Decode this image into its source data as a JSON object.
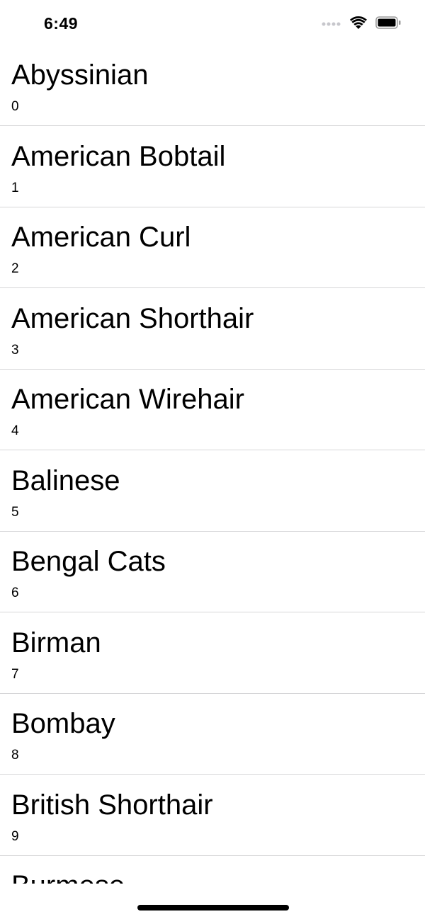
{
  "status_bar": {
    "time": "6:49",
    "icons": [
      "cellular-signal-icon",
      "wifi-icon",
      "battery-icon"
    ]
  },
  "cat_breeds": [
    {
      "name": "Abyssinian",
      "index": "0"
    },
    {
      "name": "American Bobtail",
      "index": "1"
    },
    {
      "name": "American Curl",
      "index": "2"
    },
    {
      "name": "American Shorthair",
      "index": "3"
    },
    {
      "name": "American Wirehair",
      "index": "4"
    },
    {
      "name": "Balinese",
      "index": "5"
    },
    {
      "name": "Bengal Cats",
      "index": "6"
    },
    {
      "name": "Birman",
      "index": "7"
    },
    {
      "name": "Bombay",
      "index": "8"
    },
    {
      "name": "British Shorthair",
      "index": "9"
    },
    {
      "name": "Burmese",
      "index": ""
    }
  ],
  "colors": {
    "background": "#ffffff",
    "text": "#000000",
    "separator": "#d6d6d8",
    "signal_inactive": "#c7c7cc"
  }
}
